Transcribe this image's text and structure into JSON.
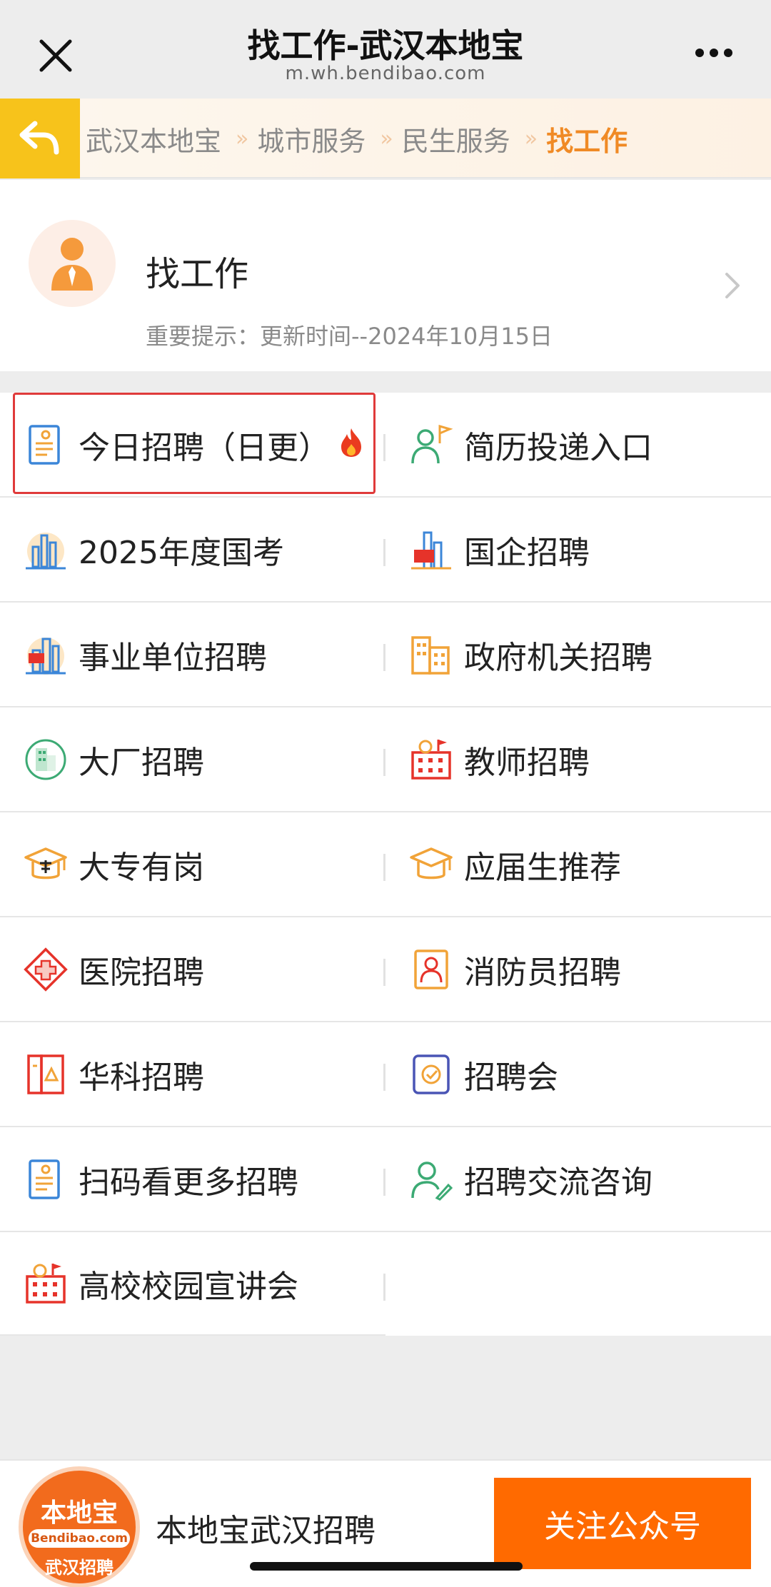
{
  "topbar": {
    "title": "找工作-武汉本地宝",
    "url": "m.wh.bendibao.com",
    "close_icon": "close-icon",
    "more_icon": "more-icon"
  },
  "breadcrumb": {
    "back_icon": "back-arrow-icon",
    "items": [
      "武汉本地宝",
      "城市服务",
      "民生服务"
    ],
    "separator": "»",
    "current": "找工作"
  },
  "header": {
    "title": "找工作",
    "note": "重要提示：更新时间--2024年10月15日",
    "icon": "job-seeker-icon"
  },
  "menu": [
    {
      "left": {
        "label": "今日招聘（日更）",
        "icon": "document-icon",
        "hot": true
      },
      "right": {
        "label": "简历投递入口",
        "icon": "person-flag-icon"
      }
    },
    {
      "left": {
        "label": "2025年度国考",
        "icon": "city-icon"
      },
      "right": {
        "label": "国企招聘",
        "icon": "state-enterprise-icon"
      }
    },
    {
      "left": {
        "label": "事业单位招聘",
        "icon": "institution-icon"
      },
      "right": {
        "label": "政府机关招聘",
        "icon": "government-building-icon"
      }
    },
    {
      "left": {
        "label": "大厂招聘",
        "icon": "company-building-icon"
      },
      "right": {
        "label": "教师招聘",
        "icon": "school-icon"
      }
    },
    {
      "left": {
        "label": "大专有岗",
        "icon": "college-cap-icon"
      },
      "right": {
        "label": "应届生推荐",
        "icon": "graduate-cap-icon"
      }
    },
    {
      "left": {
        "label": "医院招聘",
        "icon": "hospital-cross-icon"
      },
      "right": {
        "label": "消防员招聘",
        "icon": "firefighter-icon"
      }
    },
    {
      "left": {
        "label": "华科招聘",
        "icon": "university-icon"
      },
      "right": {
        "label": "招聘会",
        "icon": "job-fair-icon"
      }
    },
    {
      "left": {
        "label": "扫码看更多招聘",
        "icon": "qr-document-icon"
      },
      "right": {
        "label": "招聘交流咨询",
        "icon": "consult-person-icon"
      }
    },
    {
      "left": {
        "label": "高校校园宣讲会",
        "icon": "campus-icon"
      },
      "right": null
    }
  ],
  "footer": {
    "logo_top": "本地宝",
    "logo_mid": "Bendibao.com",
    "logo_bottom": "武汉招聘",
    "account_name": "本地宝武汉招聘",
    "follow_label": "关注公众号"
  },
  "colors": {
    "accent": "#f08a25",
    "back_bg": "#f7c31b",
    "follow_bg": "#ff6a00",
    "highlight_border": "#e03a3a"
  }
}
